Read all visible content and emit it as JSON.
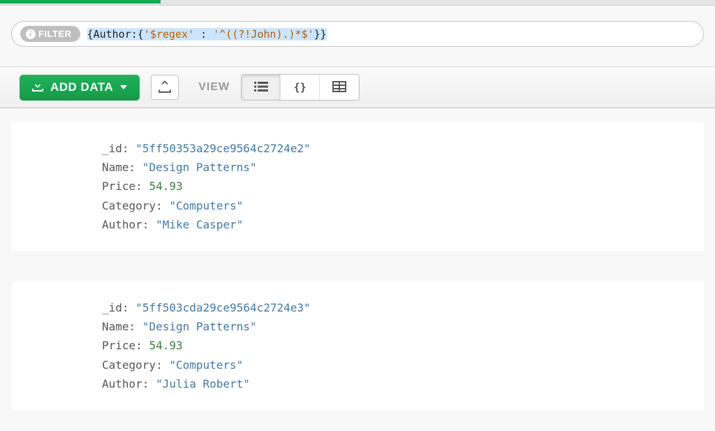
{
  "topbar": {},
  "filter": {
    "badge_label": "FILTER",
    "query": "{Author:{'$regex' : '^((?!John).)*$'}}"
  },
  "toolbar": {
    "add_data_label": "ADD DATA",
    "view_label": "VIEW"
  },
  "documents": [
    {
      "_id": "5ff50353a29ce9564c2724e2",
      "Name": "Design Patterns",
      "Price": 54.93,
      "Category": "Computers",
      "Author": "Mike Casper"
    },
    {
      "_id": "5ff503cda29ce9564c2724e3",
      "Name": "Design Patterns",
      "Price": 54.93,
      "Category": "Computers",
      "Author": "Julia Robert"
    }
  ],
  "field_labels": {
    "id": "_id",
    "name": "Name",
    "price": "Price",
    "category": "Category",
    "author": "Author"
  }
}
